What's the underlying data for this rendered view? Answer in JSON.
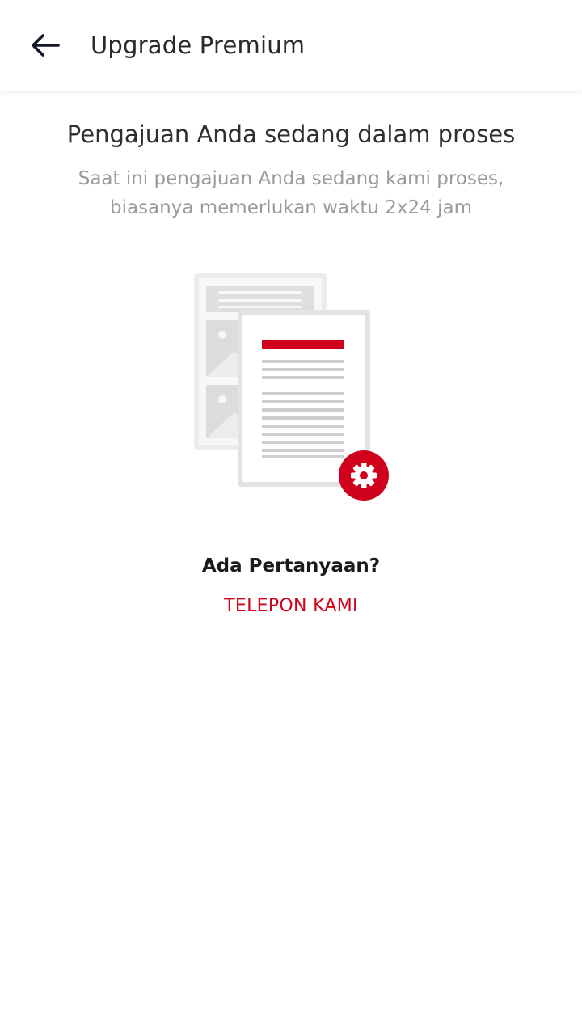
{
  "header": {
    "back_icon": "arrow-left-icon",
    "title": "Upgrade Premium"
  },
  "main": {
    "headline": "Pengajuan Anda sedang dalam proses",
    "subtext": "Saat ini pengajuan Anda sedang kami proses, biasanya memerlukan waktu 2x24 jam",
    "illustration_icon": "documents-processing-icon",
    "badge_icon": "gear-icon",
    "question": "Ada Pertanyaan?",
    "call_link": "TELEPON KAMI"
  },
  "colors": {
    "accent": "#d0021b",
    "text_primary": "#2f2f2f",
    "text_secondary": "#9a9a9a",
    "illustration_gray": "#e6e6e6"
  }
}
